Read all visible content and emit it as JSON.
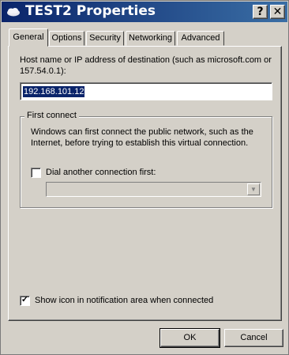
{
  "window": {
    "title": "TEST2 Properties",
    "help_label": "?",
    "close_label": "✕"
  },
  "tabs": [
    {
      "label": "General",
      "active": true
    },
    {
      "label": "Options",
      "active": false
    },
    {
      "label": "Security",
      "active": false
    },
    {
      "label": "Networking",
      "active": false
    },
    {
      "label": "Advanced",
      "active": false
    }
  ],
  "general": {
    "host_label_line1": "Host name or IP address of destination (such as microsoft.com or",
    "host_label_line2": "157.54.0.1):",
    "host_value": "192.168.101.12",
    "first_connect": {
      "title": "First connect",
      "description_line1": "Windows can first connect the public network, such as the",
      "description_line2": "Internet, before trying to establish this virtual connection.",
      "dial_label": "Dial another connection first:",
      "dial_checked": false,
      "connection_value": ""
    },
    "show_icon_label": "Show icon in notification area when connected",
    "show_icon_checked": true
  },
  "buttons": {
    "ok": "OK",
    "cancel": "Cancel"
  },
  "icons": {
    "title_icon": "network-connection-icon",
    "checkmark": "✓"
  }
}
